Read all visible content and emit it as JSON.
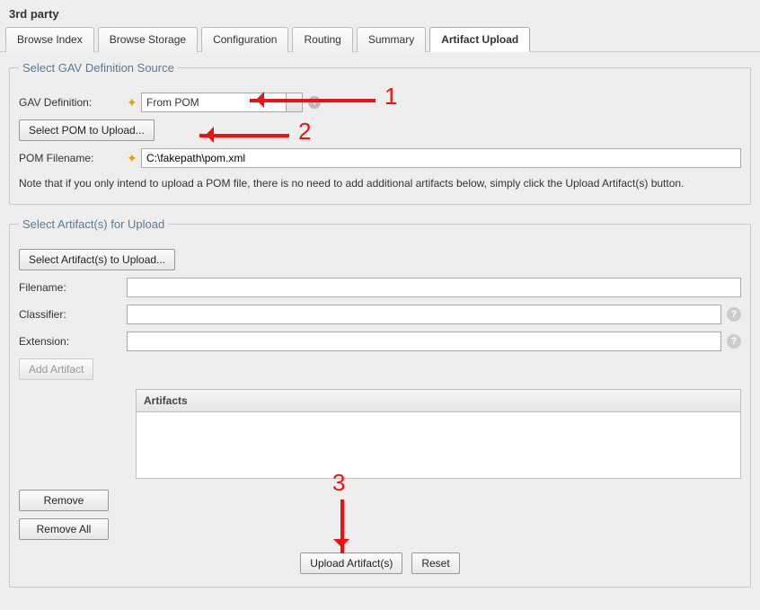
{
  "title": "3rd party",
  "tabs": [
    {
      "label": "Browse Index"
    },
    {
      "label": "Browse Storage"
    },
    {
      "label": "Configuration"
    },
    {
      "label": "Routing"
    },
    {
      "label": "Summary"
    },
    {
      "label": "Artifact Upload"
    }
  ],
  "gav_section": {
    "legend": "Select GAV Definition Source",
    "def_label": "GAV Definition:",
    "def_value": "From POM",
    "select_pom_btn": "Select POM to Upload...",
    "pom_filename_label": "POM Filename:",
    "pom_filename_value": "C:\\fakepath\\pom.xml",
    "note": "Note that if you only intend to upload a POM file, there is no need to add additional artifacts below, simply click the Upload Artifact(s) button."
  },
  "artifact_section": {
    "legend": "Select Artifact(s) for Upload",
    "select_btn": "Select Artifact(s) to Upload...",
    "filename_label": "Filename:",
    "filename_value": "",
    "classifier_label": "Classifier:",
    "classifier_value": "",
    "extension_label": "Extension:",
    "extension_value": "",
    "add_btn": "Add Artifact",
    "list_header": "Artifacts",
    "remove_btn": "Remove",
    "remove_all_btn": "Remove All",
    "upload_btn": "Upload Artifact(s)",
    "reset_btn": "Reset"
  },
  "annotations": {
    "a1": "1",
    "a2": "2",
    "a3": "3"
  }
}
